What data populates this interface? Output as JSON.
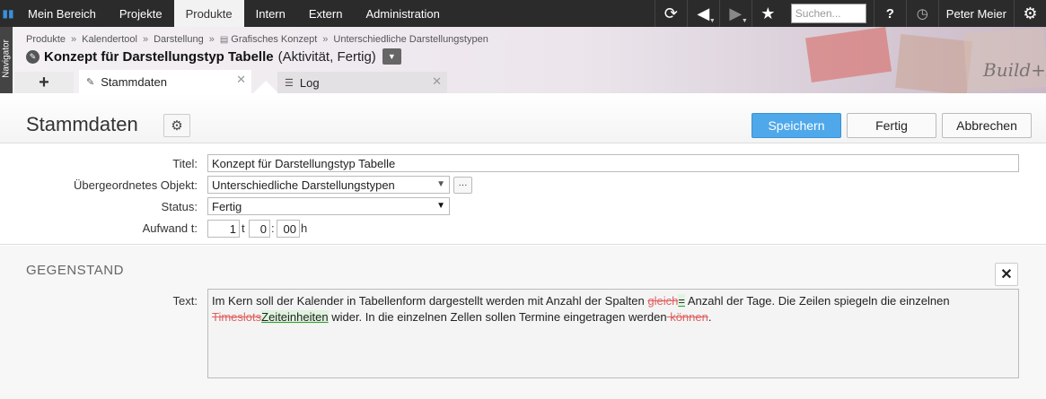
{
  "topnav": {
    "items": [
      "Mein Bereich",
      "Projekte",
      "Produkte",
      "Intern",
      "Extern",
      "Administration"
    ],
    "active": "Produkte",
    "search_placeholder": "Suchen...",
    "help_label": "?",
    "user_name": "Peter Meier"
  },
  "navigator": {
    "label": "Navigator"
  },
  "breadcrumb": [
    "Produkte",
    "Kalendertool",
    "Darstellung",
    "Grafisches Konzept",
    "Unterschiedliche Darstellungstypen"
  ],
  "breadcrumb_separator": "»",
  "header": {
    "title": "Konzept für Darstellungstyp Tabelle",
    "subtitle": "(Aktivität, Fertig)"
  },
  "tabs": {
    "add_label": "+",
    "items": [
      {
        "label": "Stammdaten",
        "icon": "activity-icon",
        "active": true
      },
      {
        "label": "Log",
        "icon": "list-icon",
        "active": false
      }
    ]
  },
  "page": {
    "title": "Stammdaten",
    "buttons": {
      "save": "Speichern",
      "done": "Fertig",
      "cancel": "Abbrechen"
    }
  },
  "form": {
    "title_label": "Titel:",
    "title_value": "Konzept für Darstellungstyp Tabelle",
    "parent_label": "Übergeordnetes Objekt:",
    "parent_value": "Unterschiedliche Darstellungstypen",
    "parent_more": "···",
    "status_label": "Status:",
    "status_value": "Fertig",
    "effort_label": "Aufwand t:",
    "effort_days": "1",
    "effort_days_unit": "t",
    "effort_hours": "0",
    "effort_sep": ":",
    "effort_minutes": "00",
    "effort_hours_unit": "h"
  },
  "gegenstand": {
    "title": "GEGENSTAND",
    "text_label": "Text:",
    "text_parts": {
      "p1": "Im Kern soll der Kalender in Tabellenform dargestellt werden mit Anzahl der Spalten ",
      "del1": "gleich",
      "ins1": "=",
      "p2": " Anzahl der Tage. Die Zeilen spiegeln die einzelnen ",
      "del2": "Timeslots",
      "ins2": "Zeiteinheiten",
      "p3": " wider. In die einzelnen Zellen sollen Termine eingetragen werden",
      "del3": " können",
      "p4": "."
    }
  },
  "colors": {
    "topbar": "#2b2b2b",
    "primary_button": "#4ea8ea",
    "deleted_text": "#e06060",
    "inserted_bg": "#dff3df"
  }
}
